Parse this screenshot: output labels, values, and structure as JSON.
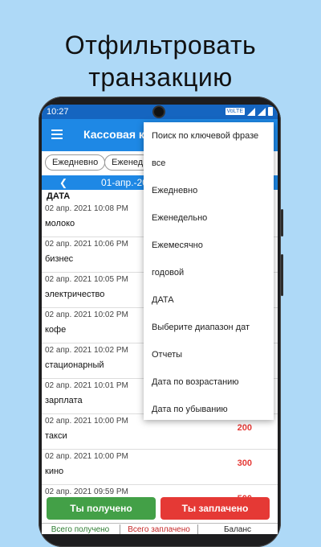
{
  "headline": [
    "Отфильтровать",
    "транзакцию"
  ],
  "status_bar": {
    "time": "10:27",
    "network": "VoLTE"
  },
  "app_bar": {
    "title": "Кассовая кн"
  },
  "filter_chips": [
    "Ежедневно",
    "Еженед"
  ],
  "date_nav": {
    "label": "01-апр.-20"
  },
  "list_header": "ДАТА",
  "transactions": [
    {
      "date": "02 апр. 2021 10:08 PM",
      "name": "молоко",
      "amount": ""
    },
    {
      "date": "02 апр. 2021 10:06 PM",
      "name": "бизнес",
      "amount": ""
    },
    {
      "date": "02 апр. 2021 10:05 PM",
      "name": "электричество",
      "amount": ""
    },
    {
      "date": "02 апр. 2021 10:02 PM",
      "name": "кофе",
      "amount": ""
    },
    {
      "date": "02 апр. 2021 10:02 PM",
      "name": "стационарный",
      "amount": ""
    },
    {
      "date": "02 апр. 2021 10:01 PM",
      "name": "зарплата",
      "amount": ""
    },
    {
      "date": "02 апр. 2021 10:00 PM",
      "name": "такси",
      "amount": "200"
    },
    {
      "date": "02 апр. 2021 10:00 PM",
      "name": "кино",
      "amount": "300"
    },
    {
      "date": "02 апр. 2021 09:59 PM",
      "name": "",
      "amount": "500"
    }
  ],
  "dropdown_menu": [
    "Поиск по ключевой фразе",
    "все",
    "Ежедневно",
    "Еженедельно",
    "Ежемесячно",
    "годовой",
    "ДАТА",
    "Выберите диапазон дат",
    "Отчеты",
    "Дата по возрастанию",
    "Дата по убыванию"
  ],
  "buttons": {
    "received": "Ты получено",
    "paid": "Ты заплачено"
  },
  "totals": {
    "received": "Всего получено",
    "paid": "Всего заплачено",
    "balance": "Баланс"
  },
  "colors": {
    "background": "#aed9f7",
    "app_bar": "#1e88e5",
    "green": "#43a047",
    "red": "#e53935"
  }
}
